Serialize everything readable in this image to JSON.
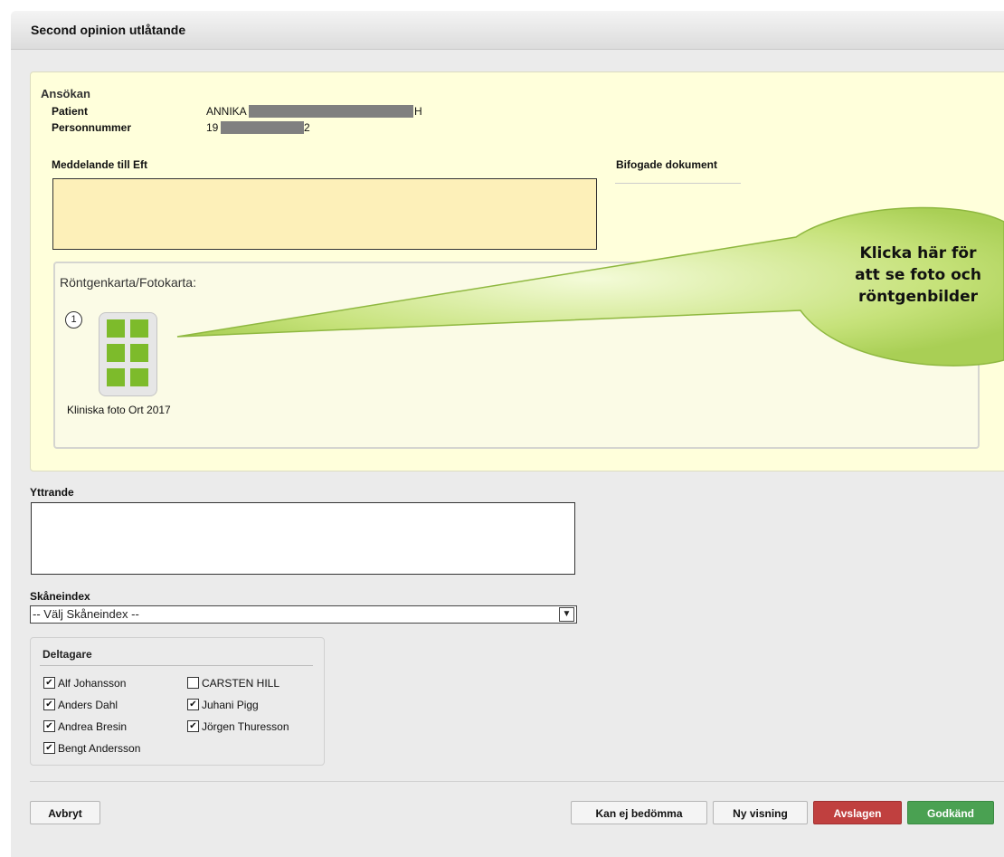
{
  "dialog": {
    "title": "Second opinion utlåtande"
  },
  "ansokan": {
    "heading": "Ansökan",
    "patient_label": "Patient",
    "patient_value_prefix": "ANNIKA",
    "patient_value_suffix": "H",
    "personnummer_label": "Personnummer",
    "personnummer_prefix": "19",
    "personnummer_suffix": "2",
    "meddelande_label": "Meddelande till Eft",
    "meddelande_value": "",
    "bifogade_label": "Bifogade dokument"
  },
  "rontgen": {
    "label": "Röntgenkarta/Fotokarta:",
    "item_number": "1",
    "item_caption": "Kliniska foto Ort 2017",
    "tile_color": "#7dbb2b"
  },
  "callout": {
    "lines": [
      "Klicka här för",
      "att se foto och",
      "röntgenbilder"
    ],
    "color": "#c6e27a"
  },
  "yttrande": {
    "label": "Yttrande",
    "value": ""
  },
  "skaneindex": {
    "label": "Skåneindex",
    "selected": "-- Välj Skåneindex --"
  },
  "deltagare": {
    "heading": "Deltagare",
    "left": [
      {
        "name": "Alf Johansson",
        "checked": true
      },
      {
        "name": "Anders Dahl",
        "checked": true
      },
      {
        "name": "Andrea Bresin",
        "checked": true
      },
      {
        "name": "Bengt Andersson",
        "checked": true
      }
    ],
    "right": [
      {
        "name": "CARSTEN HILL",
        "checked": false
      },
      {
        "name": "Juhani Pigg",
        "checked": true
      },
      {
        "name": "Jörgen Thuresson",
        "checked": true
      }
    ]
  },
  "buttons": {
    "avbryt": "Avbryt",
    "kan_ej": "Kan ej bedömma",
    "ny_visning": "Ny visning",
    "avslagen": "Avslagen",
    "godkand": "Godkänd"
  },
  "colors": {
    "panel_yellow": "#ffffdb",
    "message_box": "#fdf0b9",
    "reject_red": "#c0403f",
    "approve_green": "#4aa152"
  }
}
